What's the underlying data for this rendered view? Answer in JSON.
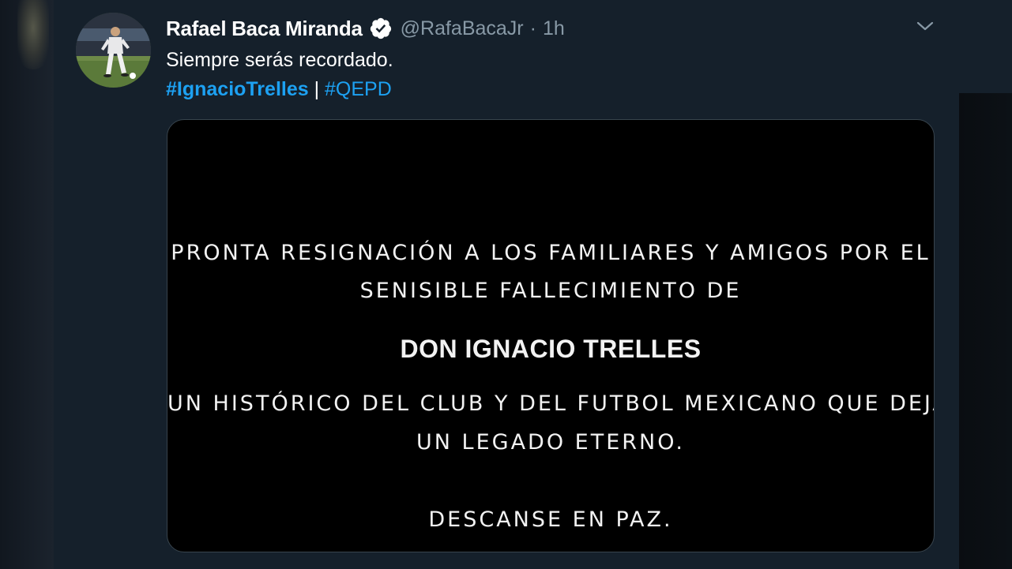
{
  "tweet": {
    "author": {
      "display_name": "Rafael Baca Miranda",
      "handle": "@RafaBacaJr",
      "verified": true,
      "avatar_icon": "player-avatar"
    },
    "time": "1h",
    "separator_dot": "·",
    "text_line1": "Siempre serás recordado.",
    "hashtags": [
      {
        "label": "#IgnacioTrelles"
      },
      {
        "label": "#QEPD"
      }
    ],
    "hashtag_separator": " | ",
    "menu_icon": "chevron-down-icon",
    "colors": {
      "background": "#15202b",
      "link": "#1da1f2",
      "secondary_text": "#8899a6",
      "card_bg": "#000000"
    },
    "media": {
      "line1": "PRONTA RESIGNACIÓN A LOS FAMILIARES Y AMIGOS POR EL",
      "line2": "SENISIBLE FALLECIMIENTO DE",
      "line3": "DON IGNACIO TRELLES",
      "line4": "UN HISTÓRICO DEL CLUB Y DEL FUTBOL MEXICANO QUE DEJA",
      "line5": "UN LEGADO ETERNO.",
      "line6": "DESCANSE EN PAZ."
    }
  }
}
